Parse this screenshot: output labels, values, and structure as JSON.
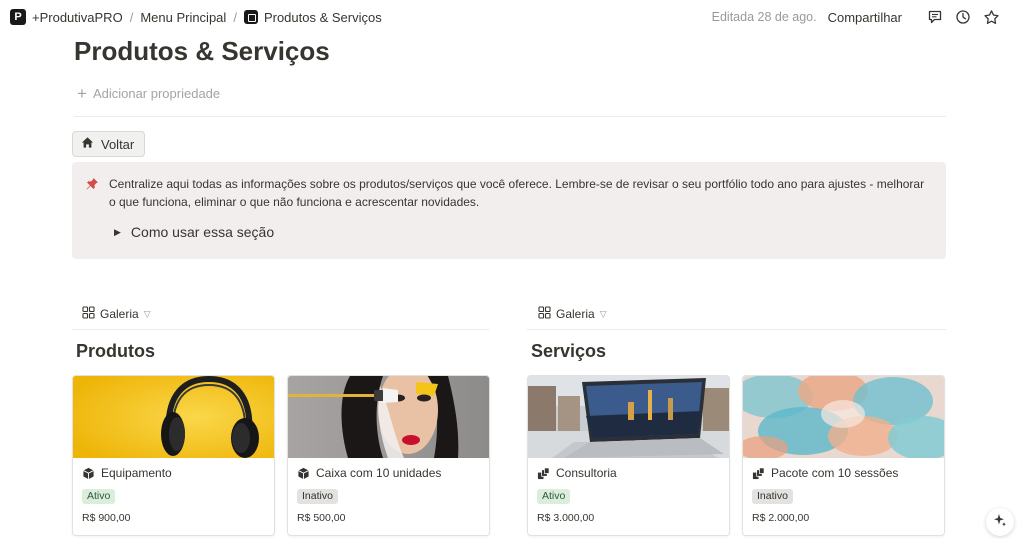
{
  "breadcrumb": {
    "workspace_logo": "P",
    "workspace": "+ProdutivaPRO",
    "parent": "Menu Principal",
    "current": "Produtos & Serviços"
  },
  "topbar": {
    "edited": "Editada 28 de ago.",
    "share_label": "Compartilhar",
    "icons": [
      "comment-icon",
      "history-icon",
      "star-icon"
    ]
  },
  "page": {
    "title": "Produtos & Serviços",
    "add_property": "Adicionar propriedade"
  },
  "back_button": {
    "label": "Voltar",
    "icon": "house-icon"
  },
  "callout": {
    "icon": "pushpin-icon",
    "text": "Centralize aqui todas as informações sobre os produtos/serviços que você oferece. Lembre-se de revisar o seu portfólio todo ano para ajustes - melhorar o que funciona, eliminar o que não funciona e acrescentar novidades.",
    "toggle_label": "Como usar essa seção"
  },
  "galleries": [
    {
      "view_label": "Galeria",
      "title": "Produtos",
      "cards": [
        {
          "name": "Equipamento",
          "status": "Ativo",
          "status_color": "#dbeddb",
          "price": "R$ 900,00",
          "cover": "headphones-yellow"
        },
        {
          "name": "Caixa com 10 unidades",
          "status": "Inativo",
          "status_color": "#e3e2e0",
          "price": "R$ 500,00",
          "cover": "makeup-portrait"
        }
      ]
    },
    {
      "view_label": "Galeria",
      "title": "Serviços",
      "cards": [
        {
          "name": "Consultoria",
          "status": "Ativo",
          "status_color": "#dbeddb",
          "price": "R$ 3.000,00",
          "cover": "laptop-city"
        },
        {
          "name": "Pacote com 10 sessões",
          "status": "Inativo",
          "status_color": "#e3e2e0",
          "price": "R$ 2.000,00",
          "cover": "colorful-smoke"
        }
      ]
    }
  ]
}
